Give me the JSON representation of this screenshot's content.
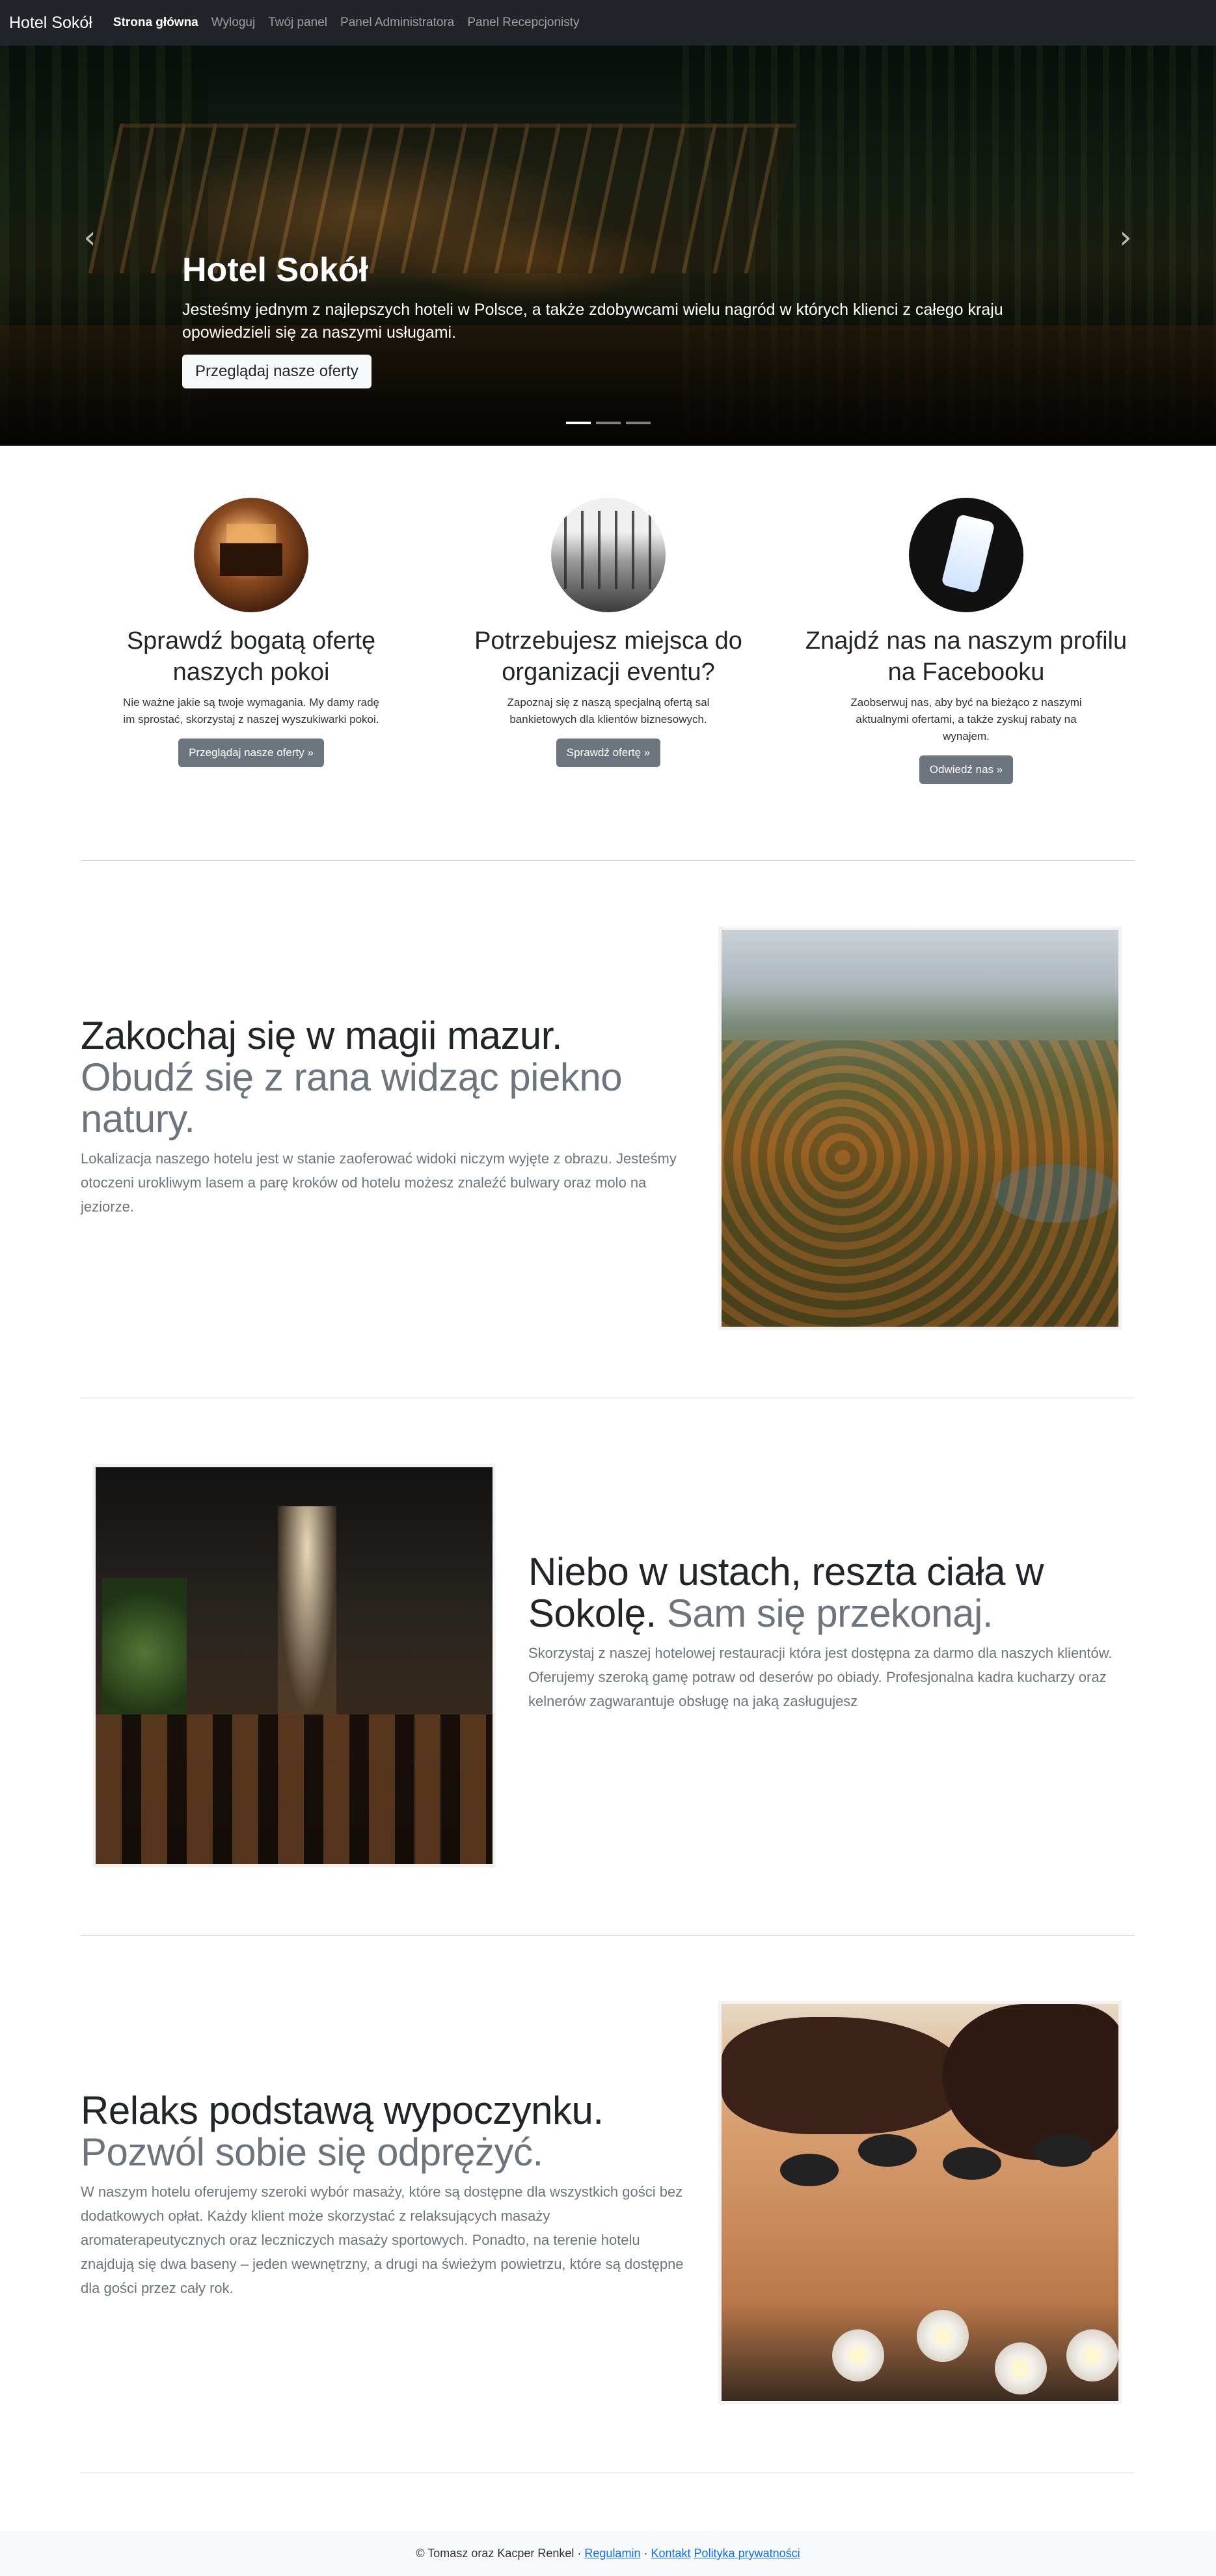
{
  "navbar": {
    "brand": "Hotel Sokół",
    "links": [
      "Strona główna",
      "Wyloguj",
      "Twój panel",
      "Panel Administratora",
      "Panel Recepcjonisty"
    ]
  },
  "carousel": {
    "title": "Hotel Sokół",
    "text": "Jesteśmy jednym z najlepszych hoteli w Polsce, a także zdobywcami wielu nagród w których klienci z całego kraju opowiedzieli się za naszymi usługami.",
    "button": "Przeglądaj nasze oferty",
    "prev_icon": "‹",
    "next_icon": "›",
    "slides": 3,
    "active_slide": 1
  },
  "features": [
    {
      "title": "Sprawdź bogatą ofertę naszych pokoi",
      "text": "Nie ważne jakie są twoje wymagania. My damy radę im sprostać, skorzystaj z naszej wyszukiwarki pokoi.",
      "button": "Przeglądaj nasze oferty »",
      "image": "hotel-room"
    },
    {
      "title": "Potrzebujesz miejsca do organizacji eventu?",
      "text": "Zapoznaj się z naszą specjalną ofertą sal bankietowych dla klientów biznesowych.",
      "button": "Sprawdź ofertę »",
      "image": "banquet-hall"
    },
    {
      "title": "Znajdź nas na naszym profilu na Facebooku",
      "text": "Zaobserwuj nas, aby być na bieżąco z naszymi aktualnymi ofertami, a także zyskuj rabaty na wynajem.",
      "button": "Odwiedź nas »",
      "image": "facebook-phone"
    }
  ],
  "featurettes": [
    {
      "heading": "Zakochaj się w magii mazur.",
      "subheading": "Obudź się z rana widząc piekno natury.",
      "text": "Lokalizacja naszego hotelu jest w stanie zaoferować widoki niczym wyjęte z obrazu. Jesteśmy otoczeni urokliwym lasem a parę kroków od hotelu możesz znaleźć bulwary oraz molo na jeziorze.",
      "image": "forest-lake"
    },
    {
      "heading": "Niebo w ustach, reszta ciała w Sokolę.",
      "subheading": "Sam się przekonaj.",
      "text": "Skorzystaj z naszej hotelowej restauracji która jest dostępna za darmo dla naszych klientów. Oferujemy szeroką gamę potraw od deserów po obiady. Profesjonalna kadra kucharzy oraz kelnerów zagwarantuje obsługę na jaką zasługujesz",
      "image": "restaurant"
    },
    {
      "heading": "Relaks podstawą wypoczynku.",
      "subheading": "Pozwól sobie się odprężyć.",
      "text": "W naszym hotelu oferujemy szeroki wybór masaży, które są dostępne dla wszystkich gości bez dodatkowych opłat. Każdy klient może skorzystać z relaksujących masaży aromaterapeutycznych oraz leczniczych masaży sportowych. Ponadto, na terenie hotelu znajdują się dwa baseny – jeden wewnętrzny, a drugi na świeżym powietrzu, które są dostępne dla gości przez cały rok.",
      "image": "stone-massage"
    }
  ],
  "footer": {
    "copyright": "© Tomasz oraz Kacper Renkel ·",
    "links": [
      "Regulamin",
      "Kontakt",
      "Polityka prywatności"
    ],
    "separator": "·"
  },
  "colors": {
    "navbar_bg": "#212529",
    "button_secondary": "#6c757d",
    "link": "#0d6efd"
  }
}
